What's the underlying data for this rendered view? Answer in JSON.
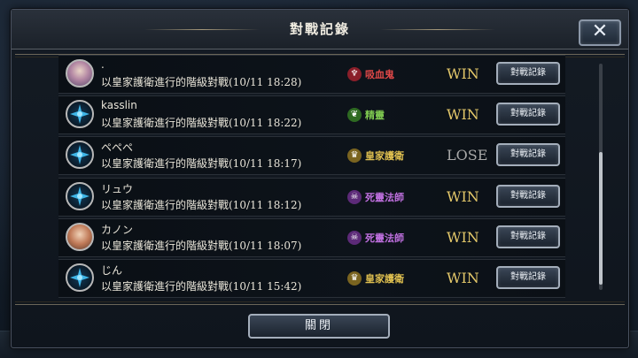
{
  "dialog": {
    "title": "對戰記錄",
    "close_icon": "close-icon",
    "close_button_label": "關閉"
  },
  "colors": {
    "win": "#e5c96a",
    "lose": "#a8a8a8",
    "vampire": "#e04848",
    "elf": "#7ec850",
    "royal": "#e0c050",
    "necro": "#c070e0"
  },
  "battles": [
    {
      "name": ".",
      "avatar": "portrait",
      "description": "以皇家護衛進行的階級對戰(10/11 18:28)",
      "class_label": "吸血鬼",
      "class_icon": "vampire-icon",
      "class_color": "#e04848",
      "result": "WIN",
      "button": "對戰記錄"
    },
    {
      "name": "kasslin",
      "avatar": "emblem",
      "description": "以皇家護衛進行的階級對戰(10/11 18:22)",
      "class_label": "精靈",
      "class_icon": "elf-icon",
      "class_color": "#7ec850",
      "result": "WIN",
      "button": "對戰記錄"
    },
    {
      "name": "ペペペ",
      "avatar": "emblem",
      "description": "以皇家護衛進行的階級對戰(10/11 18:17)",
      "class_label": "皇家護衛",
      "class_icon": "royal-icon",
      "class_color": "#e0c050",
      "result": "LOSE",
      "button": "對戰記錄"
    },
    {
      "name": "リュウ",
      "avatar": "emblem",
      "description": "以皇家護衛進行的階級對戰(10/11 18:12)",
      "class_label": "死靈法師",
      "class_icon": "necromancer-icon",
      "class_color": "#c070e0",
      "result": "WIN",
      "button": "對戰記錄"
    },
    {
      "name": "カノン",
      "avatar": "portrait2",
      "description": "以皇家護衛進行的階級對戰(10/11 18:07)",
      "class_label": "死靈法師",
      "class_icon": "necromancer-icon",
      "class_color": "#c070e0",
      "result": "WIN",
      "button": "對戰記錄"
    },
    {
      "name": "じん",
      "avatar": "emblem",
      "description": "以皇家護衛進行的階級對戰(10/11 15:42)",
      "class_label": "皇家護衛",
      "class_icon": "royal-icon",
      "class_color": "#e0c050",
      "result": "WIN",
      "button": "對戰記錄"
    }
  ]
}
